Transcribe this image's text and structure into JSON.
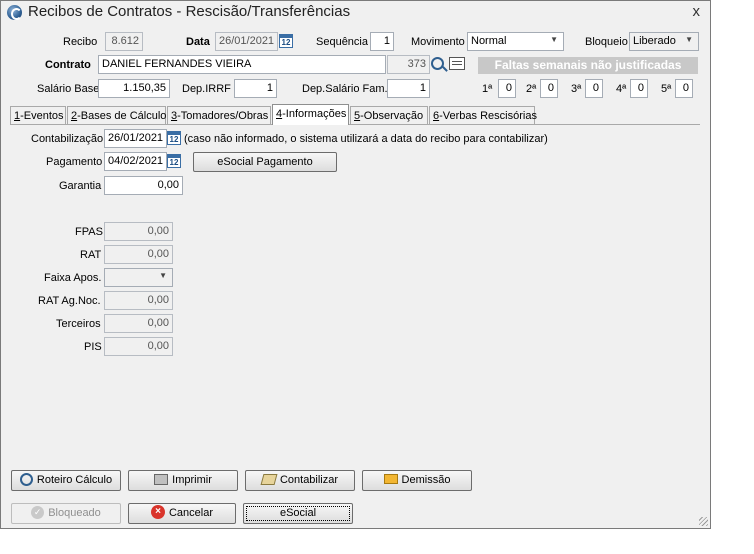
{
  "window": {
    "title": "Recibos de Contratos - Rescisão/Transferências",
    "close": "x"
  },
  "header": {
    "recibo_label": "Recibo",
    "recibo_value": "8.612",
    "data_label": "Data",
    "data_value": "26/01/2021",
    "sequencia_label": "Sequência",
    "sequencia_value": "1",
    "movimento_label": "Movimento",
    "movimento_value": "Normal",
    "bloqueio_label": "Bloqueio",
    "bloqueio_value": "Liberado",
    "contrato_label": "Contrato",
    "contrato_value": "DANIEL FERNANDES VIEIRA",
    "contrato_code": "373",
    "salario_label": "Salário Base",
    "salario_value": "1.150,35",
    "depirrf_label": "Dep.IRRF",
    "depirrf_value": "1",
    "depsal_label": "Dep.Salário Fam.",
    "depsal_value": "1",
    "faltas_banner": "Faltas semanais não justificadas",
    "faltas": [
      {
        "label": "1ª",
        "value": "0"
      },
      {
        "label": "2ª",
        "value": "0"
      },
      {
        "label": "3ª",
        "value": "0"
      },
      {
        "label": "4ª",
        "value": "0"
      },
      {
        "label": "5ª",
        "value": "0"
      }
    ]
  },
  "tabs": [
    {
      "key": "1",
      "rest": "-Eventos"
    },
    {
      "key": "2",
      "rest": "-Bases de Cálculo"
    },
    {
      "key": "3",
      "rest": "-Tomadores/Obras"
    },
    {
      "key": "4",
      "rest": "-Informações"
    },
    {
      "key": "5",
      "rest": "-Observação"
    },
    {
      "key": "6",
      "rest": "-Verbas Rescisórias"
    }
  ],
  "info": {
    "contabilizacao_label": "Contabilização",
    "contabilizacao_value": "26/01/2021",
    "contabilizacao_hint": "(caso não informado, o sistema utilizará a data do recibo para contabilizar)",
    "pagamento_label": "Pagamento",
    "pagamento_value": "04/02/2021",
    "esocial_pagamento_label": "eSocial Pagamento",
    "garantia_label": "Garantia",
    "garantia_value": "0,00",
    "fpas_label": "FPAS",
    "fpas_value": "0,00",
    "rat_label": "RAT",
    "rat_value": "0,00",
    "faixa_label": "Faixa Apos.",
    "faixa_value": "",
    "ratag_label": "RAT Ag.Noc.",
    "ratag_value": "0,00",
    "terceiros_label": "Terceiros",
    "terceiros_value": "0,00",
    "pis_label": "PIS",
    "pis_value": "0,00",
    "calendar_glyph": "12"
  },
  "buttons": {
    "roteiro": "Roteiro Cálculo",
    "imprimir": "Imprimir",
    "contabilizar": "Contabilizar",
    "demissao": "Demissão",
    "bloqueado": "Bloqueado",
    "cancelar": "Cancelar",
    "esocial": "eSocial"
  }
}
